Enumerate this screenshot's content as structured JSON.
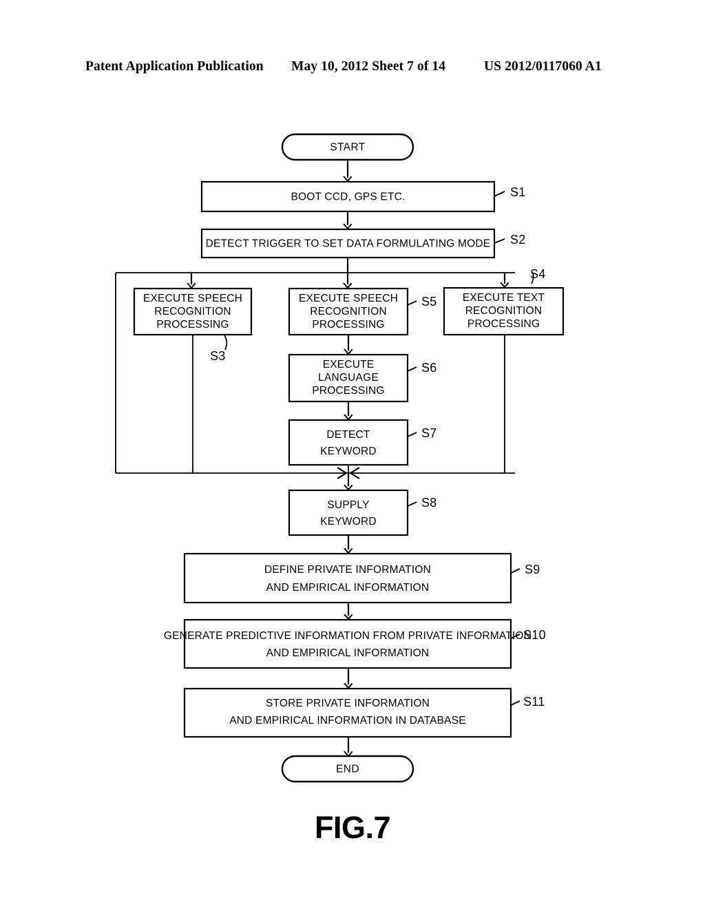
{
  "header": {
    "left": "Patent Application Publication",
    "middle": "May 10, 2012  Sheet 7 of 14",
    "right": "US 2012/0117060 A1"
  },
  "figure": {
    "caption": "FIG.7",
    "type": "flowchart"
  },
  "flowchart": {
    "start_terminal": "START",
    "end_terminal": "END",
    "nodes": [
      {
        "id": "s1",
        "ref": "S1",
        "lines": [
          "BOOT CCD, GPS ETC."
        ]
      },
      {
        "id": "s2",
        "ref": "S2",
        "lines": [
          "DETECT TRIGGER TO SET DATA FORMULATING MODE"
        ]
      },
      {
        "id": "s3",
        "ref": "S3",
        "lines": [
          "EXECUTE SPEECH",
          "RECOGNITION",
          "PROCESSING"
        ]
      },
      {
        "id": "s5",
        "ref": "S5",
        "lines": [
          "EXECUTE SPEECH",
          "RECOGNITION",
          "PROCESSING"
        ]
      },
      {
        "id": "s4",
        "ref": "S4",
        "lines": [
          "EXECUTE TEXT",
          "RECOGNITION",
          "PROCESSING"
        ]
      },
      {
        "id": "s6",
        "ref": "S6",
        "lines": [
          "EXECUTE",
          "LANGUAGE",
          "PROCESSING"
        ]
      },
      {
        "id": "s7",
        "ref": "S7",
        "lines": [
          "DETECT",
          "KEYWORD"
        ]
      },
      {
        "id": "s8",
        "ref": "S8",
        "lines": [
          "SUPPLY",
          "KEYWORD"
        ]
      },
      {
        "id": "s9",
        "ref": "S9",
        "lines": [
          "DEFINE PRIVATE INFORMATION",
          "AND EMPIRICAL INFORMATION"
        ]
      },
      {
        "id": "s10",
        "ref": "S10",
        "lines": [
          "GENERATE PREDICTIVE INFORMATION FROM PRIVATE INFORMATION",
          "AND EMPIRICAL INFORMATION"
        ]
      },
      {
        "id": "s11",
        "ref": "S11",
        "lines": [
          "STORE PRIVATE INFORMATION",
          "AND EMPIRICAL INFORMATION IN DATABASE"
        ]
      }
    ]
  },
  "colors": {
    "ink": "#000000",
    "paper": "#ffffff"
  }
}
